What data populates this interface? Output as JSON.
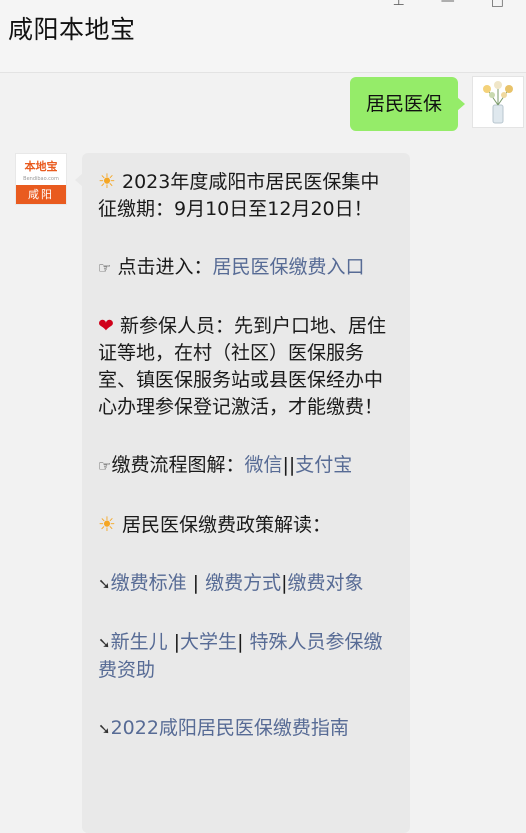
{
  "window": {
    "title": "咸阳本地宝",
    "controls": [
      "pin",
      "minimize",
      "maximize"
    ]
  },
  "outgoing": {
    "text": "居民医保"
  },
  "incoming_avatar": {
    "logo_text": "本地宝",
    "logo_sub": "Bendibao.com",
    "city": "咸阳"
  },
  "message": {
    "p1": {
      "icon": "☀",
      "text": " 2023年度咸阳市居民医保集中征缴期：9月10日至12月20日！"
    },
    "p2": {
      "icon": "☞",
      "prefix": " 点击进入：",
      "link": "居民医保缴费入口"
    },
    "p3": {
      "icon": "❤",
      "text": " 新参保人员：先到户口地、居住证等地，在村（社区）医保服务室、镇医保服务站或县医保经办中心办理参保登记激活，才能缴费！"
    },
    "p4": {
      "icon": "☞",
      "prefix": "缴费流程图解：",
      "link1": "微信",
      "sep": "||",
      "link2": "支付宝"
    },
    "p5": {
      "icon": "☀",
      "text": " 居民医保缴费政策解读："
    },
    "p6": {
      "icon": "➘",
      "link1": "缴费标准",
      "sep1": " | ",
      "link2": "缴费方式",
      "sep2": "|",
      "link3": "缴费对象"
    },
    "p7": {
      "icon": "➘",
      "link1": "新生儿",
      "sep1": " |",
      "link2": "大学生",
      "sep2": "| ",
      "link3": "特殊人员参保缴费资助"
    },
    "p8": {
      "icon": "➘",
      "link": "2022咸阳居民医保缴费指南"
    }
  }
}
